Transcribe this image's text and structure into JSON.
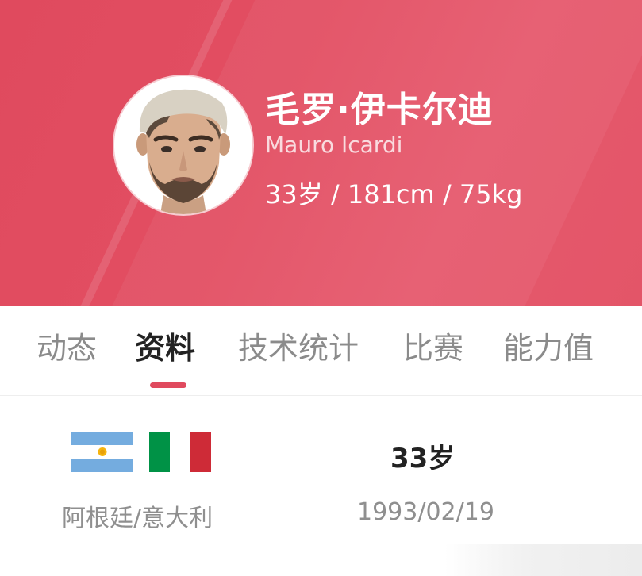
{
  "profile": {
    "name_zh": "毛罗·伊卡尔迪",
    "name_en": "Mauro Icardi",
    "stats": "33岁 / 181cm / 75kg",
    "theme_color": "#e04a5e"
  },
  "tabs": [
    {
      "label": "动态",
      "active": false
    },
    {
      "label": "资料",
      "active": true
    },
    {
      "label": "技术统计",
      "active": false
    },
    {
      "label": "比赛",
      "active": false
    },
    {
      "label": "能力值",
      "active": false
    }
  ],
  "info": {
    "flags": [
      "argentina-flag",
      "italy-flag"
    ],
    "country": "阿根廷/意大利",
    "age": "33岁",
    "birthdate": "1993/02/19"
  }
}
